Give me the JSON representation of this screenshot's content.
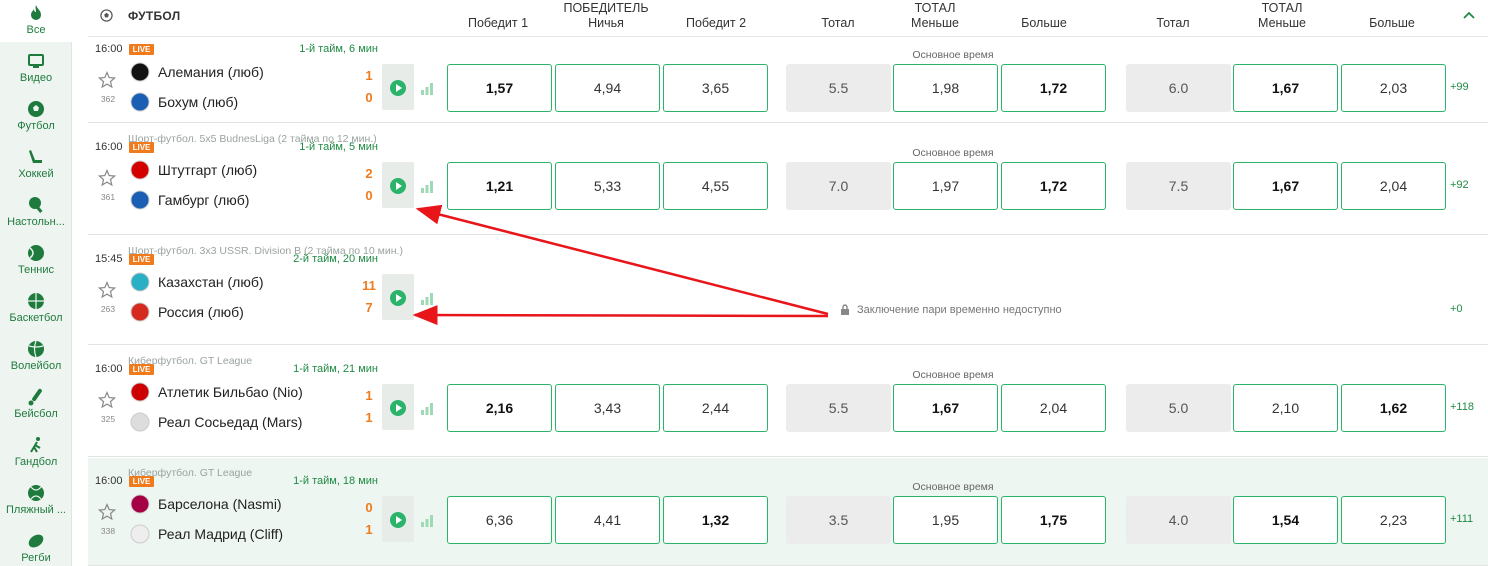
{
  "sidebar": {
    "items": [
      {
        "label": "Все",
        "icon": "fire-icon"
      },
      {
        "label": "Видео",
        "icon": "monitor-icon"
      },
      {
        "label": "Футбол",
        "icon": "soccer-ball-icon"
      },
      {
        "label": "Хоккей",
        "icon": "hockey-stick-icon"
      },
      {
        "label": "Настольн...",
        "icon": "table-tennis-icon"
      },
      {
        "label": "Теннис",
        "icon": "tennis-ball-icon"
      },
      {
        "label": "Баскетбол",
        "icon": "basketball-icon"
      },
      {
        "label": "Волейбол",
        "icon": "volleyball-icon"
      },
      {
        "label": "Бейсбол",
        "icon": "baseball-bat-icon"
      },
      {
        "label": "Гандбол",
        "icon": "handball-icon"
      },
      {
        "label": "Пляжный ...",
        "icon": "beach-volleyball-icon"
      },
      {
        "label": "Регби",
        "icon": "rugby-ball-icon"
      }
    ]
  },
  "header": {
    "sport": "ФУТБОЛ",
    "col_win1": "Победит 1",
    "col_winner_group": "ПОБЕДИТЕЛЬ",
    "col_draw": "Ничья",
    "col_win2": "Победит 2",
    "col_total1": "Тотал",
    "col_total_group1": "ТОТАЛ",
    "col_less1": "Меньше",
    "col_more1": "Больше",
    "col_total2": "Тотал",
    "col_total_group2": "ТОТАЛ",
    "col_less2": "Меньше",
    "col_more2": "Больше"
  },
  "live_badge": "LIVE",
  "main_time_label": "Основное время",
  "locked_text": "Заключение пари временно недоступно",
  "matches": [
    {
      "league": "",
      "time": "16:00",
      "period": "1-й тайм, 6 мин",
      "id": "362",
      "team1": "Алемания (люб)",
      "team2": "Бохум (люб)",
      "score1": "1",
      "score2": "0",
      "win1": "1,57",
      "draw": "4,94",
      "win2": "3,65",
      "total1": "5.5",
      "less1": "1,98",
      "more1": "1,72",
      "total2": "6.0",
      "less2": "1,67",
      "more2": "2,03",
      "more_count": "+99"
    },
    {
      "league": "Шорт-футбол. 5x5 BudnesLiga (2 тайма по 12 мин.)",
      "time": "16:00",
      "period": "1-й тайм, 5 мин",
      "id": "361",
      "team1": "Штутгарт (люб)",
      "team2": "Гамбург (люб)",
      "score1": "2",
      "score2": "0",
      "win1": "1,21",
      "draw": "5,33",
      "win2": "4,55",
      "total1": "7.0",
      "less1": "1,97",
      "more1": "1,72",
      "total2": "7.5",
      "less2": "1,67",
      "more2": "2,04",
      "more_count": "+92"
    },
    {
      "league": "Шорт-футбол. 3x3 USSR. Division B (2 тайма по 10 мин.)",
      "time": "15:45",
      "period": "2-й тайм, 20 мин",
      "id": "263",
      "team1": "Казахстан (люб)",
      "team2": "Россия (люб)",
      "score1": "11",
      "score2": "7",
      "more_count": "+0"
    },
    {
      "league": "Киберфутбол. GT League",
      "time": "16:00",
      "period": "1-й тайм, 21 мин",
      "id": "325",
      "team1": "Атлетик Бильбао (Nio)",
      "team2": "Реал Сосьедад (Mars)",
      "score1": "1",
      "score2": "1",
      "win1": "2,16",
      "draw": "3,43",
      "win2": "2,44",
      "total1": "5.5",
      "less1": "1,67",
      "more1": "2,04",
      "total2": "5.0",
      "less2": "2,10",
      "more2": "1,62",
      "more_count": "+118"
    },
    {
      "league": "Киберфутбол. GT League",
      "time": "16:00",
      "period": "1-й тайм, 18 мин",
      "id": "338",
      "team1": "Барселона (Nasmi)",
      "team2": "Реал Мадрид (Cliff)",
      "score1": "0",
      "score2": "1",
      "win1": "6,36",
      "draw": "4,41",
      "win2": "1,32",
      "total1": "3.5",
      "less1": "1,95",
      "more1": "1,75",
      "total2": "4.0",
      "less2": "1,54",
      "more2": "2,23",
      "more_count": "+111"
    }
  ],
  "colors": {
    "accent_green": "#1f8a45",
    "odd_border": "#2bb36a",
    "live_orange": "#f07b1d",
    "annotation_red": "#e8161b"
  }
}
